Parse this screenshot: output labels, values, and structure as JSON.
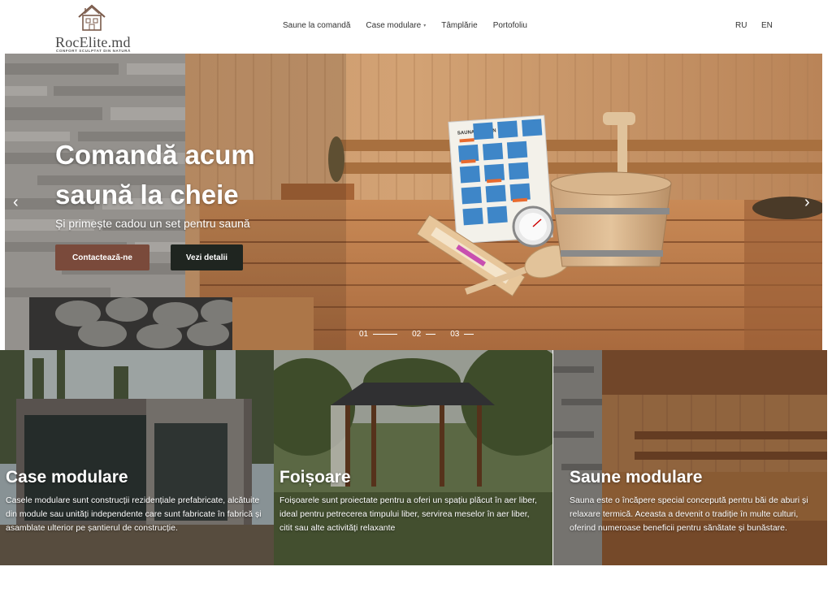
{
  "header": {
    "logo": {
      "name": "RocElite.md",
      "tagline": "CONFORT SCULPTAT DIN NATURĂ",
      "icon": "house-icon"
    },
    "nav": [
      {
        "label": "Saune la comandă"
      },
      {
        "label": "Case modulare",
        "has_dropdown": true
      },
      {
        "label": "Tâmplărie"
      },
      {
        "label": "Portofoliu"
      }
    ],
    "languages": [
      "RU",
      "EN"
    ]
  },
  "hero": {
    "title": "Comandă acum saună la cheie",
    "subtitle": "Și primește cadou un set pentru saună",
    "primary_button": "Contactează-ne",
    "secondary_button": "Vezi detalii",
    "prev_icon": "chevron-left-icon",
    "next_icon": "chevron-right-icon",
    "slides": [
      "01",
      "02",
      "03"
    ],
    "active_slide": "01",
    "poster_title": "SAUNA REGELN"
  },
  "cards": [
    {
      "title": "Case modulare",
      "text": "Casele modulare sunt construcții rezidențiale prefabricate, alcătuite din module sau unități independente care sunt fabricate în fabrică și asamblate ulterior pe șantierul de construcție."
    },
    {
      "title": "Foișoare",
      "text": "Foișoarele sunt proiectate pentru a oferi un spațiu plăcut în aer liber, ideal pentru petrecerea timpului liber, servirea meselor în aer liber, citit sau alte activități relaxante"
    },
    {
      "title": "Saune modulare",
      "text": "Sauna este o încăpere special concepută pentru băi de aburi și relaxare termică. Aceasta a devenit o tradiție în multe culturi, oferind numeroase beneficii pentru sănătate și bunăstare."
    }
  ],
  "colors": {
    "accent": "#7a4a3b",
    "dark_button": "#1f2520",
    "wood": "#c08a5c"
  }
}
